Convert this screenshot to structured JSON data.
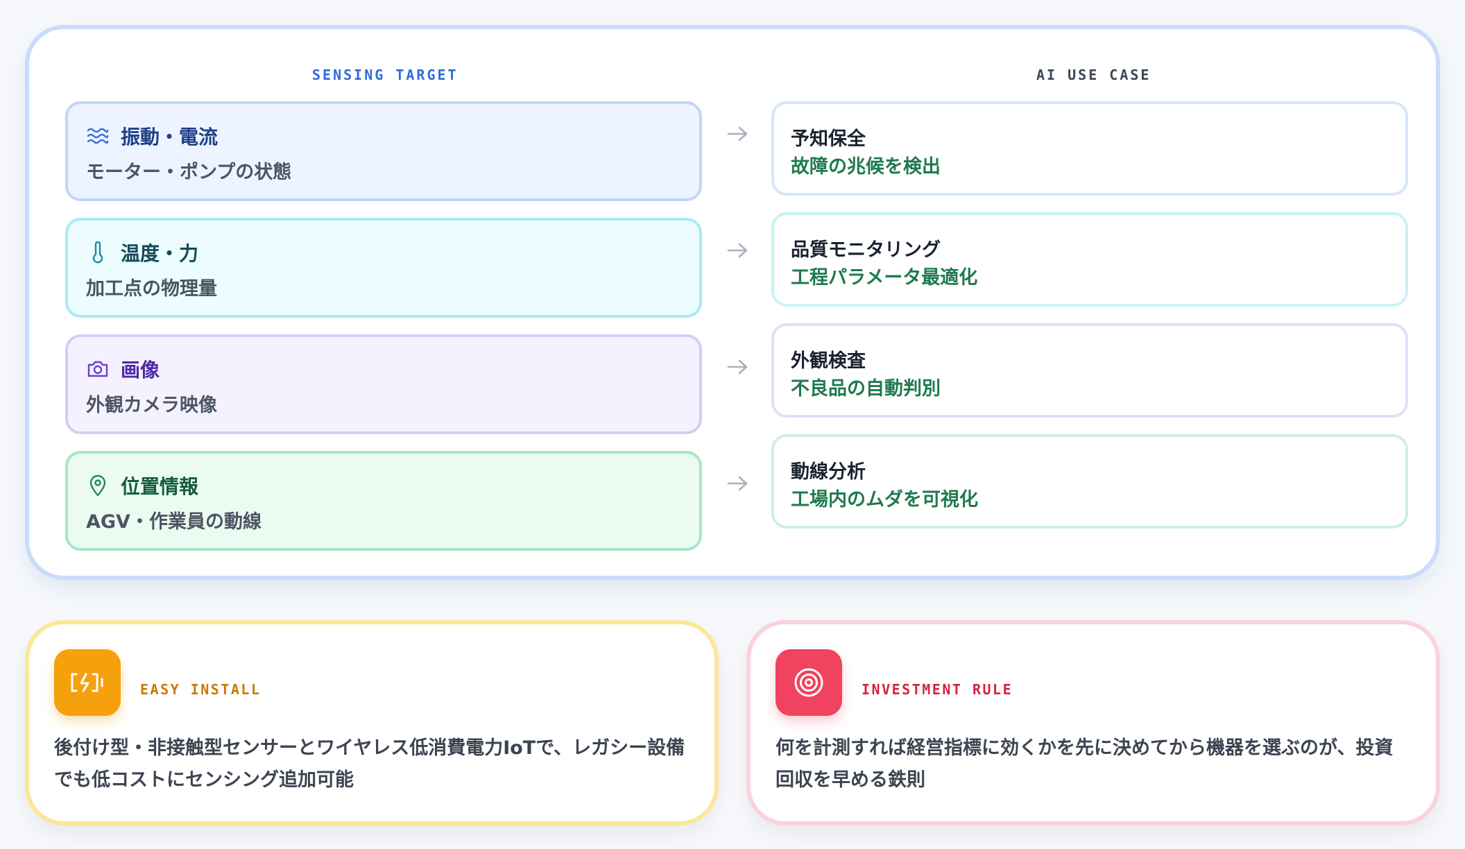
{
  "columns": {
    "sensing_label": "SENSING TARGET",
    "ai_label": "AI USE CASE"
  },
  "sensing": [
    {
      "icon": "waves-icon",
      "title": "振動・電流",
      "desc": "モーター・ポンプの状態",
      "color": "#1e3f8a"
    },
    {
      "icon": "thermometer-icon",
      "title": "温度・力",
      "desc": "加工点の物理量",
      "color": "#15495a"
    },
    {
      "icon": "camera-icon",
      "title": "画像",
      "desc": "外観カメラ映像",
      "color": "#4d2aa3"
    },
    {
      "icon": "map-pin-icon",
      "title": "位置情報",
      "desc": "AGV・作業員の動線",
      "color": "#135c3c"
    }
  ],
  "ai_cases": [
    {
      "title": "予知保全",
      "sub": "故障の兆候を検出"
    },
    {
      "title": "品質モニタリング",
      "sub": "工程パラメータ最適化"
    },
    {
      "title": "外観検査",
      "sub": "不良品の自動判別"
    },
    {
      "title": "動線分析",
      "sub": "工場内のムダを可視化"
    }
  ],
  "easy_install": {
    "icon": "battery-charging-icon",
    "label": "EASY INSTALL",
    "body": "後付け型・非接触型センサーとワイヤレス低消費電力IoTで、レガシー設備でも低コストにセンシング追加可能",
    "accent": "#f29a0c"
  },
  "investment_rule": {
    "icon": "target-icon",
    "label": "INVESTMENT RULE",
    "body": "何を計測すれば経営指標に効くかを先に決めてから機器を選ぶのが、投資回収を早める鉄則",
    "accent": "#f0435f"
  }
}
